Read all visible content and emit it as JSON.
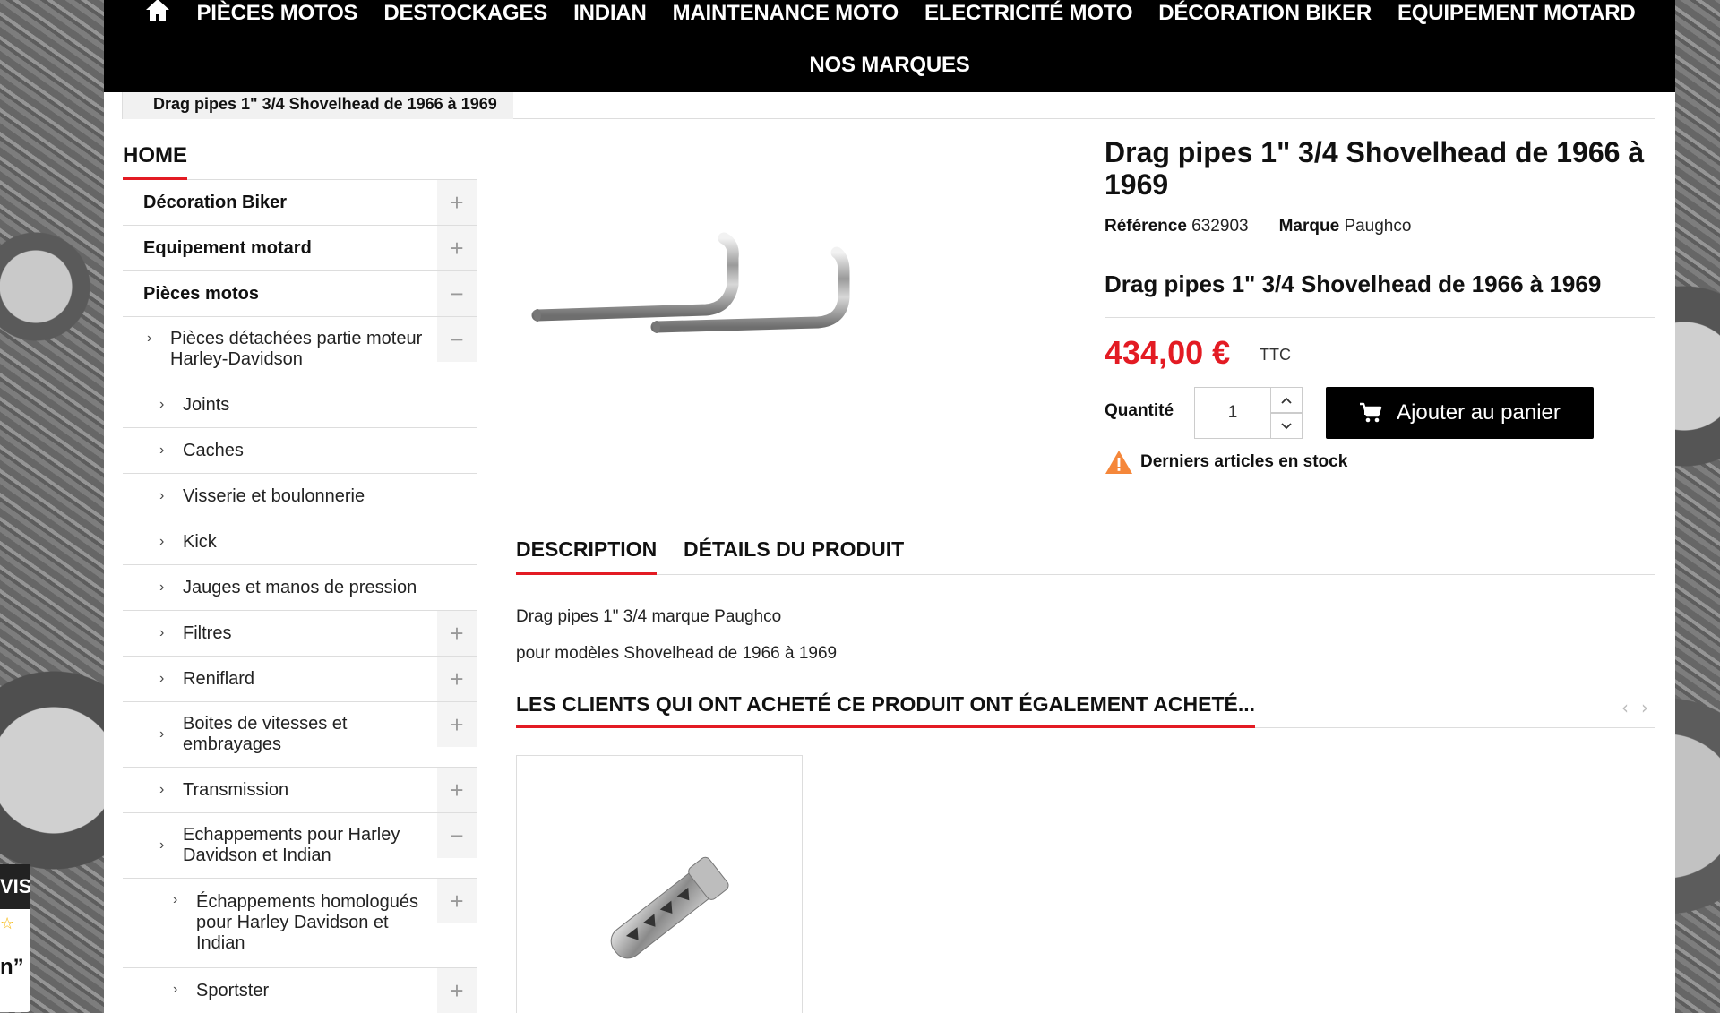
{
  "nav": {
    "row1": [
      "PIÈCES MOTOS",
      "DESTOCKAGES",
      "INDIAN",
      "MAINTENANCE MOTO",
      "ELECTRICITÉ MOTO",
      "DÉCORATION BIKER",
      "EQUIPEMENT MOTARD"
    ],
    "row2": [
      "NOS MARQUES"
    ]
  },
  "breadcrumb": {
    "current": "Drag pipes 1\" 3/4 Shovelhead de 1966 à 1969"
  },
  "sidebar": {
    "title": "HOME",
    "items": [
      {
        "label": "Décoration Biker",
        "level": 0,
        "toggle": "+"
      },
      {
        "label": "Equipement motard",
        "level": 0,
        "toggle": "+"
      },
      {
        "label": "Pièces motos",
        "level": 0,
        "toggle": "−"
      },
      {
        "label": "Pièces détachées partie moteur Harley-Davidson",
        "level": 1,
        "toggle": "−"
      },
      {
        "label": "Joints",
        "level": 2,
        "toggle": ""
      },
      {
        "label": "Caches",
        "level": 2,
        "toggle": ""
      },
      {
        "label": "Visserie et boulonnerie",
        "level": 2,
        "toggle": ""
      },
      {
        "label": "Kick",
        "level": 2,
        "toggle": ""
      },
      {
        "label": "Jauges et manos de pression",
        "level": 2,
        "toggle": ""
      },
      {
        "label": "Filtres",
        "level": 2,
        "toggle": "+"
      },
      {
        "label": "Reniflard",
        "level": 2,
        "toggle": "+"
      },
      {
        "label": "Boites de vitesses et embrayages",
        "level": 2,
        "toggle": "+"
      },
      {
        "label": "Transmission",
        "level": 2,
        "toggle": "+"
      },
      {
        "label": "Echappements pour Harley Davidson et Indian",
        "level": 2,
        "toggle": "−"
      },
      {
        "label": "Échappements homologués pour Harley Davidson et Indian",
        "level": 3,
        "toggle": "+"
      },
      {
        "label": "Sportster",
        "level": 3,
        "toggle": "+"
      }
    ]
  },
  "product": {
    "title": "Drag pipes 1\" 3/4 Shovelhead de 1966 à 1969",
    "reference_label": "Référence",
    "reference_value": "632903",
    "brand_label": "Marque",
    "brand_value": "Paughco",
    "subtitle": "Drag pipes 1\" 3/4 Shovelhead de 1966 à 1969",
    "price": "434,00 €",
    "tax": "TTC",
    "quantity_label": "Quantité",
    "quantity_value": "1",
    "add_to_cart": "Ajouter au panier",
    "stock_notice": "Derniers articles en stock"
  },
  "tabs": [
    {
      "label": "DESCRIPTION",
      "active": true
    },
    {
      "label": "DÉTAILS DU PRODUIT",
      "active": false
    }
  ],
  "description": {
    "line1": "Drag pipes 1\" 3/4 marque Paughco",
    "line2": "pour modèles  Shovelhead de 1966 à 1969"
  },
  "also_bought": {
    "title": "LES CLIENTS QUI ONT ACHETÉ CE PRODUIT ONT ÉGALEMENT ACHETÉ..."
  },
  "avis_widget": {
    "head": "VIS",
    "quote": "n”"
  },
  "colors": {
    "accent": "#e31b23",
    "nav_bg": "#000000",
    "warning": "#f5873a"
  }
}
